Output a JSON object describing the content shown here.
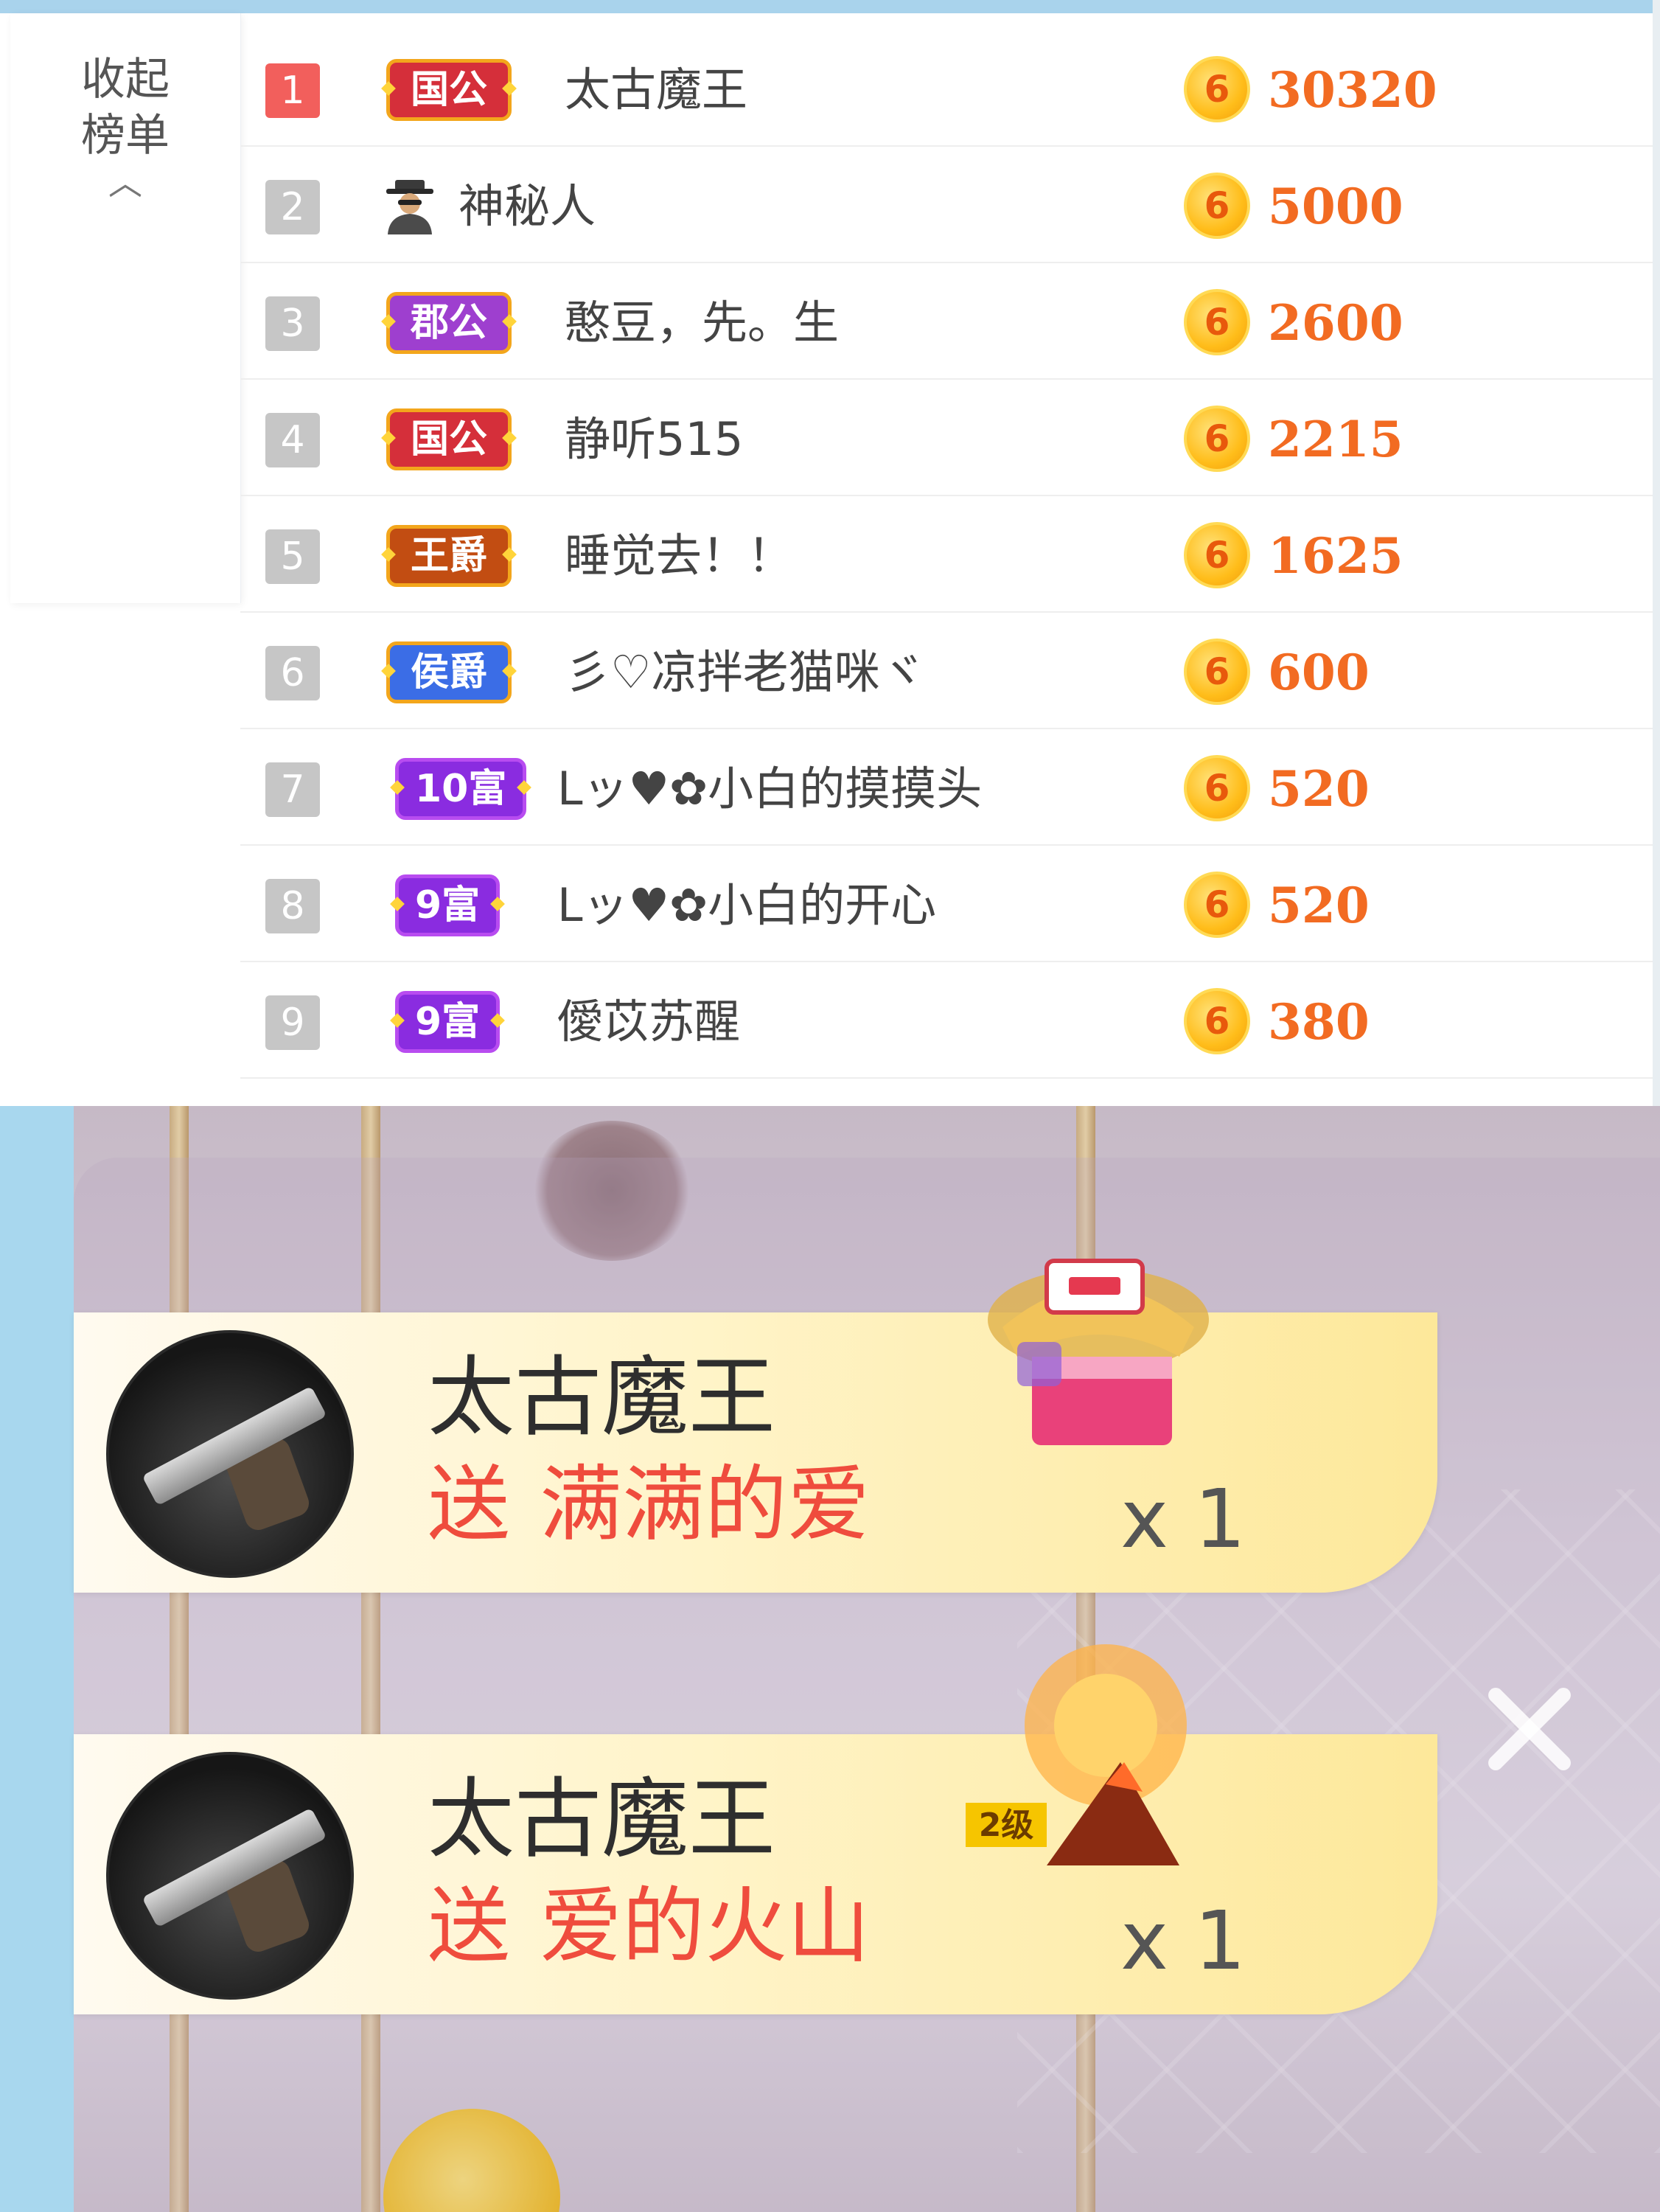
{
  "rank_panel": {
    "collapse_label_line1": "收起",
    "collapse_label_line2": "榜单",
    "collapse_chevron": "︿",
    "rows": [
      {
        "rank": "1",
        "badge": "国公",
        "badge_type": "guogong",
        "name": "太古魔王",
        "amount": "30320"
      },
      {
        "rank": "2",
        "badge": "",
        "badge_type": "mystery",
        "icon": "mystery-person-icon",
        "name": "神秘人",
        "amount": "5000"
      },
      {
        "rank": "3",
        "badge": "郡公",
        "badge_type": "jungong",
        "name": "憨豆，先。生",
        "amount": "2600"
      },
      {
        "rank": "4",
        "badge": "国公",
        "badge_type": "guogong",
        "name": "静听515",
        "amount": "2215"
      },
      {
        "rank": "5",
        "badge": "王爵",
        "badge_type": "wangjue",
        "name": "睡觉去！！",
        "amount": "1625"
      },
      {
        "rank": "6",
        "badge": "侯爵",
        "badge_type": "houjue",
        "name": "彡♡凉拌老猫咪ヾ",
        "amount": "600"
      },
      {
        "rank": "7",
        "badge": "10富",
        "badge_type": "fu",
        "name": "Lッ♥✿小白的摸摸头",
        "amount": "520"
      },
      {
        "rank": "8",
        "badge": "9富",
        "badge_type": "fu",
        "name": "Lッ♥✿小白的开心",
        "amount": "520"
      },
      {
        "rank": "9",
        "badge": "9富",
        "badge_type": "fu",
        "name": "僾苡苏醒",
        "amount": "380"
      }
    ],
    "coin_glyph": "6",
    "colors": {
      "amount": "#f26b22",
      "rank_first": "#f25f5c",
      "rank_other": "#c6c6c6",
      "coin": "#ffbd1a"
    }
  },
  "gift_feed": {
    "items": [
      {
        "sender": "太古魔王",
        "verb": "送",
        "gift": "满满的爱",
        "count": "x 1",
        "icon": "gift-box-icon"
      },
      {
        "sender": "太古魔王",
        "verb": "送",
        "gift": "爱的火山",
        "count": "x 1",
        "icon": "volcano-gift-icon",
        "tag": "2级"
      }
    ],
    "close_icon": "close-icon",
    "colors": {
      "gift_text": "#ef4c3d",
      "card": "#fff4c9"
    }
  }
}
